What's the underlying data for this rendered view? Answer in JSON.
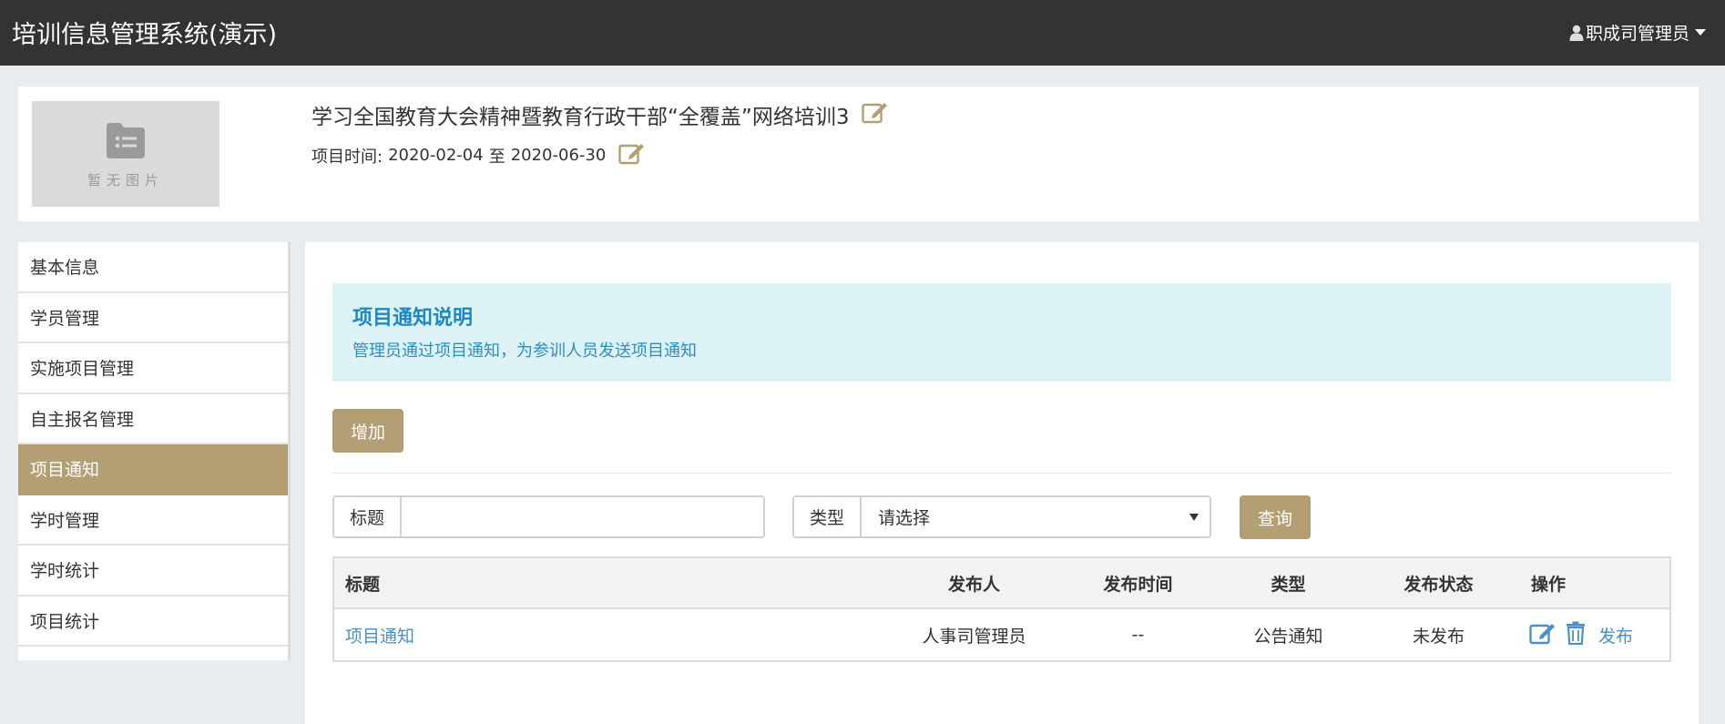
{
  "app": {
    "title": "培训信息管理系统(演示)"
  },
  "user": {
    "name": "职成司管理员",
    "icon": "user-icon"
  },
  "project": {
    "thumbnail_text": "暂无图片",
    "title": "学习全国教育大会精神暨教育行政干部“全覆盖”网络培训3",
    "time_label": "项目时间:",
    "start": "2020-02-04",
    "range_sep": "至",
    "end": "2020-06-30"
  },
  "sidebar": {
    "items": [
      {
        "label": "基本信息"
      },
      {
        "label": "学员管理"
      },
      {
        "label": "实施项目管理"
      },
      {
        "label": "自主报名管理"
      },
      {
        "label": "项目通知",
        "active": true
      },
      {
        "label": "学时管理"
      },
      {
        "label": "学时统计"
      },
      {
        "label": "项目统计"
      }
    ]
  },
  "notice": {
    "title": "项目通知说明",
    "desc": "管理员通过项目通知，为参训人员发送项目通知"
  },
  "toolbar": {
    "add_label": "增加"
  },
  "filter": {
    "title_label": "标题",
    "title_value": "",
    "type_label": "类型",
    "type_selected": "请选择",
    "query_label": "查询"
  },
  "table": {
    "headers": {
      "title": "标题",
      "publisher": "发布人",
      "time": "发布时间",
      "type": "类型",
      "status": "发布状态",
      "ops": "操作"
    },
    "rows": [
      {
        "title": "项目通知",
        "publisher": "人事司管理员",
        "time": "--",
        "type": "公告通知",
        "status": "未发布",
        "publish_label": "发布"
      }
    ]
  },
  "colors": {
    "topbar": "#333333",
    "accent": "#b49e74",
    "link": "#4a90c6",
    "alert_bg": "#dcf2f5",
    "alert_text": "#1d89c0"
  }
}
